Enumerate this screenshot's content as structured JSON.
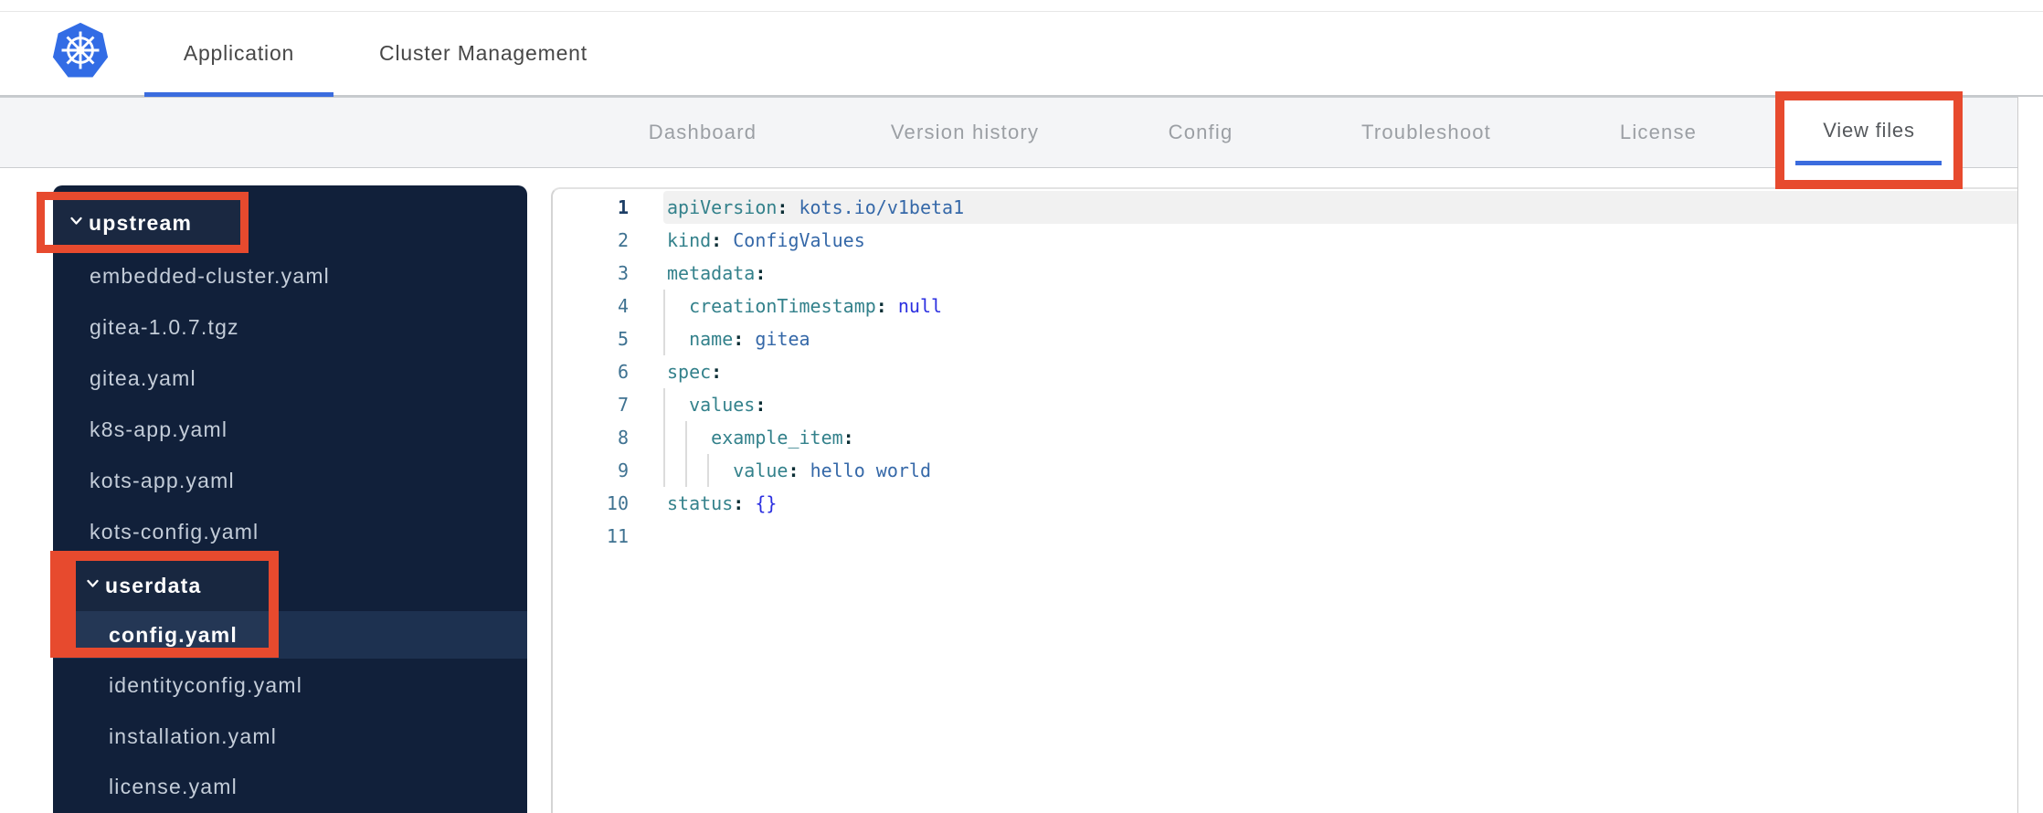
{
  "header": {
    "tabs": [
      {
        "label": "Application",
        "active": true
      },
      {
        "label": "Cluster Management",
        "active": false
      }
    ]
  },
  "nav": {
    "items": [
      {
        "label": "Dashboard",
        "center": 769
      },
      {
        "label": "Version history",
        "center": 1056
      },
      {
        "label": "Config",
        "center": 1314
      },
      {
        "label": "Troubleshoot",
        "center": 1561
      },
      {
        "label": "License",
        "center": 1815
      }
    ],
    "active_item": {
      "label": "View files"
    }
  },
  "file_tree": {
    "items": [
      {
        "label": "upstream",
        "type": "folder",
        "expanded": true,
        "level": 1
      },
      {
        "label": "embedded-cluster.yaml",
        "type": "file",
        "level": 1
      },
      {
        "label": "gitea-1.0.7.tgz",
        "type": "file",
        "level": 1
      },
      {
        "label": "gitea.yaml",
        "type": "file",
        "level": 1
      },
      {
        "label": "k8s-app.yaml",
        "type": "file",
        "level": 1
      },
      {
        "label": "kots-app.yaml",
        "type": "file",
        "level": 1
      },
      {
        "label": "kots-config.yaml",
        "type": "file",
        "level": 1
      },
      {
        "label": "userdata",
        "type": "folder",
        "expanded": true,
        "level": 2
      },
      {
        "label": "config.yaml",
        "type": "file",
        "level": 2,
        "selected": true
      },
      {
        "label": "identityconfig.yaml",
        "type": "file",
        "level": 2
      },
      {
        "label": "installation.yaml",
        "type": "file",
        "level": 2
      },
      {
        "label": "license.yaml",
        "type": "file",
        "level": 2
      }
    ]
  },
  "editor": {
    "lines": [
      {
        "num": "1",
        "indent": 0,
        "active": true,
        "tokens": [
          [
            "key",
            "apiVersion"
          ],
          [
            "colon",
            ": "
          ],
          [
            "str",
            "kots.io/v1beta1"
          ]
        ]
      },
      {
        "num": "2",
        "indent": 0,
        "tokens": [
          [
            "key",
            "kind"
          ],
          [
            "colon",
            ": "
          ],
          [
            "str",
            "ConfigValues"
          ]
        ]
      },
      {
        "num": "3",
        "indent": 0,
        "tokens": [
          [
            "key",
            "metadata"
          ],
          [
            "colon",
            ":"
          ]
        ]
      },
      {
        "num": "4",
        "indent": 2,
        "tokens": [
          [
            "key",
            "creationTimestamp"
          ],
          [
            "colon",
            ": "
          ],
          [
            "special",
            "null"
          ]
        ]
      },
      {
        "num": "5",
        "indent": 2,
        "tokens": [
          [
            "key",
            "name"
          ],
          [
            "colon",
            ": "
          ],
          [
            "str",
            "gitea"
          ]
        ]
      },
      {
        "num": "6",
        "indent": 0,
        "tokens": [
          [
            "key",
            "spec"
          ],
          [
            "colon",
            ":"
          ]
        ]
      },
      {
        "num": "7",
        "indent": 2,
        "tokens": [
          [
            "key",
            "values"
          ],
          [
            "colon",
            ":"
          ]
        ]
      },
      {
        "num": "8",
        "indent": 4,
        "tokens": [
          [
            "key",
            "example_item"
          ],
          [
            "colon",
            ":"
          ]
        ]
      },
      {
        "num": "9",
        "indent": 6,
        "tokens": [
          [
            "key",
            "value"
          ],
          [
            "colon",
            ": "
          ],
          [
            "str",
            "hello world"
          ]
        ]
      },
      {
        "num": "10",
        "indent": 0,
        "tokens": [
          [
            "key",
            "status"
          ],
          [
            "colon",
            ": "
          ],
          [
            "special",
            "{}"
          ]
        ]
      },
      {
        "num": "11",
        "indent": 0,
        "tokens": []
      }
    ]
  },
  "annotations": {
    "boxes": [
      "view-files-tab",
      "upstream-folder",
      "userdata-config-yaml"
    ]
  },
  "colors": {
    "accent_blue": "#3b6cde",
    "annotation_red": "#e74a2e",
    "sidebar_bg": "#11203a",
    "sidebar_selected_bg": "#1d3150",
    "code_key": "#33818b",
    "code_value": "#3568a8",
    "code_special": "#2b2fe0",
    "kubernetes_blue": "#326ce5"
  }
}
